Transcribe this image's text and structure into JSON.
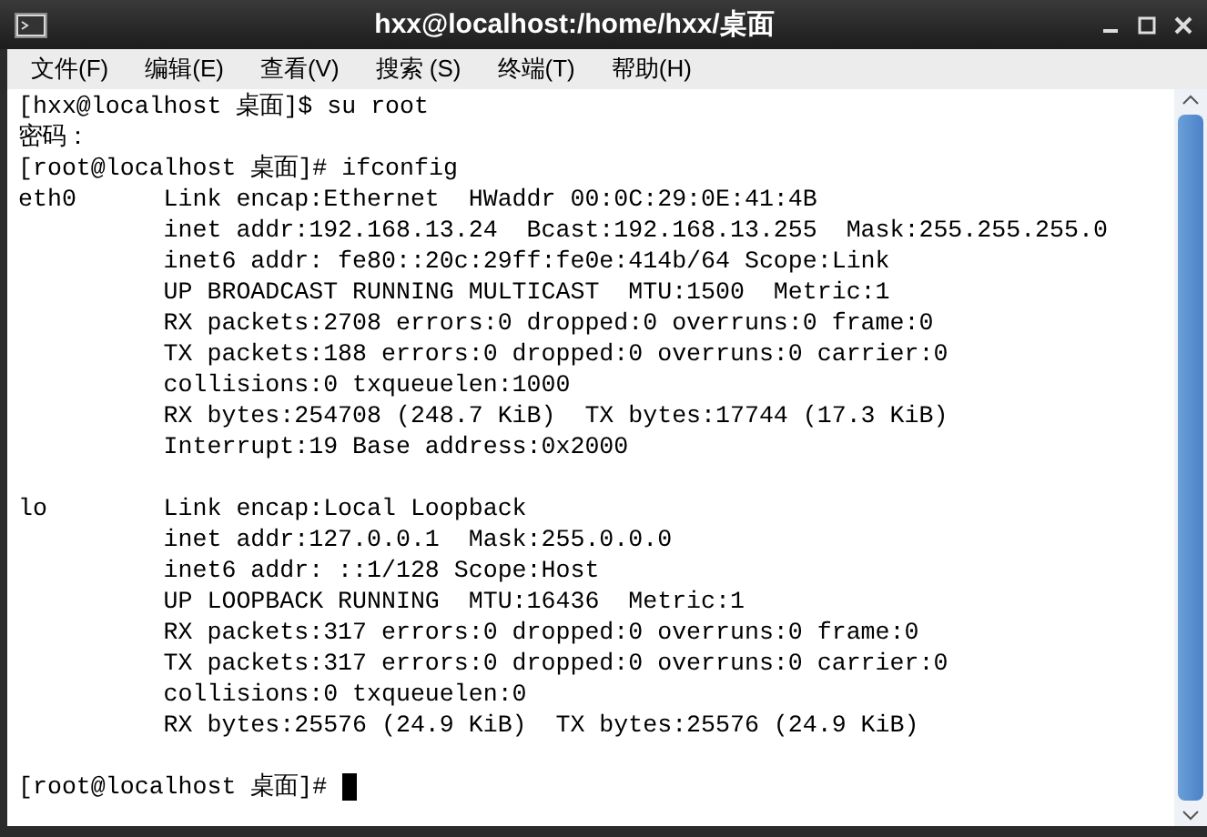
{
  "window": {
    "title": "hxx@localhost:/home/hxx/桌面"
  },
  "menu": [
    "文件(F)",
    "编辑(E)",
    "查看(V)",
    "搜索 (S)",
    "终端(T)",
    "帮助(H)"
  ],
  "terminal": {
    "lines": [
      {
        "kind": "text",
        "text": "[hxx@localhost 桌面]$ su root"
      },
      {
        "kind": "text",
        "text": "密码："
      },
      {
        "kind": "text",
        "text": "[root@localhost 桌面]# ifconfig"
      },
      {
        "kind": "text",
        "text": "eth0      Link encap:Ethernet  HWaddr 00:0C:29:0E:41:4B"
      },
      {
        "kind": "text",
        "text": "          inet addr:192.168.13.24  Bcast:192.168.13.255  Mask:255.255.255.0"
      },
      {
        "kind": "text",
        "text": "          inet6 addr: fe80::20c:29ff:fe0e:414b/64 Scope:Link"
      },
      {
        "kind": "text",
        "text": "          UP BROADCAST RUNNING MULTICAST  MTU:1500  Metric:1"
      },
      {
        "kind": "text",
        "text": "          RX packets:2708 errors:0 dropped:0 overruns:0 frame:0"
      },
      {
        "kind": "text",
        "text": "          TX packets:188 errors:0 dropped:0 overruns:0 carrier:0"
      },
      {
        "kind": "text",
        "text": "          collisions:0 txqueuelen:1000"
      },
      {
        "kind": "text",
        "text": "          RX bytes:254708 (248.7 KiB)  TX bytes:17744 (17.3 KiB)"
      },
      {
        "kind": "text",
        "text": "          Interrupt:19 Base address:0x2000"
      },
      {
        "kind": "blank"
      },
      {
        "kind": "text",
        "text": "lo        Link encap:Local Loopback"
      },
      {
        "kind": "text",
        "text": "          inet addr:127.0.0.1  Mask:255.0.0.0"
      },
      {
        "kind": "text",
        "text": "          inet6 addr: ::1/128 Scope:Host"
      },
      {
        "kind": "text",
        "text": "          UP LOOPBACK RUNNING  MTU:16436  Metric:1"
      },
      {
        "kind": "text",
        "text": "          RX packets:317 errors:0 dropped:0 overruns:0 frame:0"
      },
      {
        "kind": "text",
        "text": "          TX packets:317 errors:0 dropped:0 overruns:0 carrier:0"
      },
      {
        "kind": "text",
        "text": "          collisions:0 txqueuelen:0"
      },
      {
        "kind": "text",
        "text": "          RX bytes:25576 (24.9 KiB)  TX bytes:25576 (24.9 KiB)"
      },
      {
        "kind": "blank"
      },
      {
        "kind": "prompt",
        "text": "[root@localhost 桌面]#"
      }
    ]
  }
}
